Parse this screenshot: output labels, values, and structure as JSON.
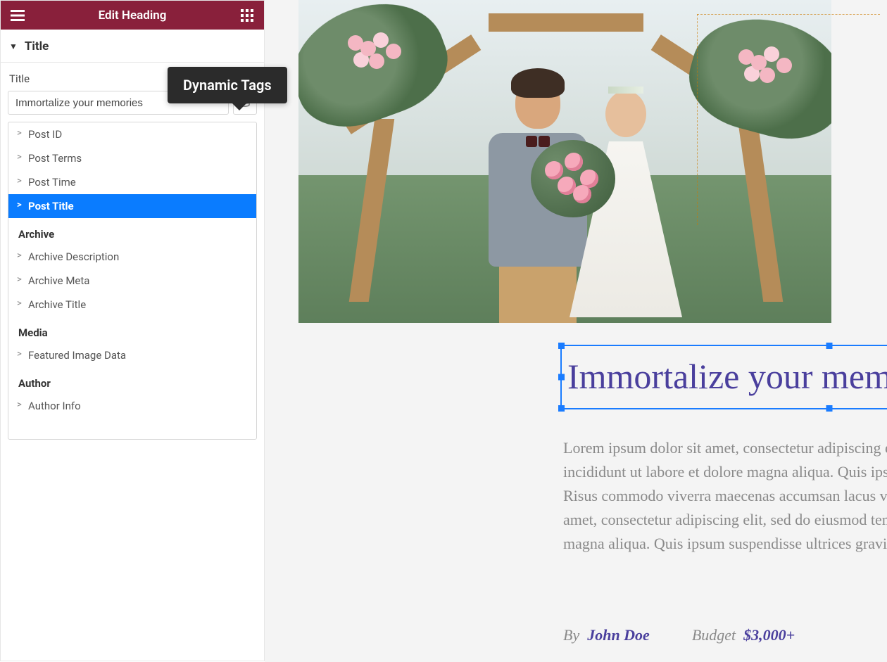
{
  "panel": {
    "title": "Edit Heading",
    "section": "Title",
    "fieldLabel": "Title",
    "inputValue": "Immortalize your memories"
  },
  "tooltip": "Dynamic Tags",
  "dropdown": {
    "groups": [
      {
        "label": null,
        "items": [
          "Post ID",
          "Post Terms",
          "Post Time",
          "Post Title"
        ],
        "activeIndex": 3
      },
      {
        "label": "Archive",
        "items": [
          "Archive Description",
          "Archive Meta",
          "Archive Title"
        ]
      },
      {
        "label": "Media",
        "items": [
          "Featured Image Data"
        ]
      },
      {
        "label": "Author",
        "items": [
          "Author Info"
        ]
      }
    ]
  },
  "page": {
    "headline": "Immortalize your memories",
    "paragraph": "Lorem ipsum dolor sit amet, consectetur adipiscing elit, sed do eiusmod tempor incididunt ut labore et dolore magna aliqua. Quis ipsum suspendisse ultrices gravida. Risus commodo viverra maecenas accumsan lacus vel facilisis. Lorem ipsum dolor sit amet, consectetur adipiscing elit, sed do eiusmod tempor incididunt ut labore et dolore magna aliqua. Quis ipsum suspendisse ultrices gravida.",
    "byLabel": "By",
    "byValue": "John Doe",
    "budgetLabel": "Budget",
    "budgetValue": "$3,000+"
  }
}
